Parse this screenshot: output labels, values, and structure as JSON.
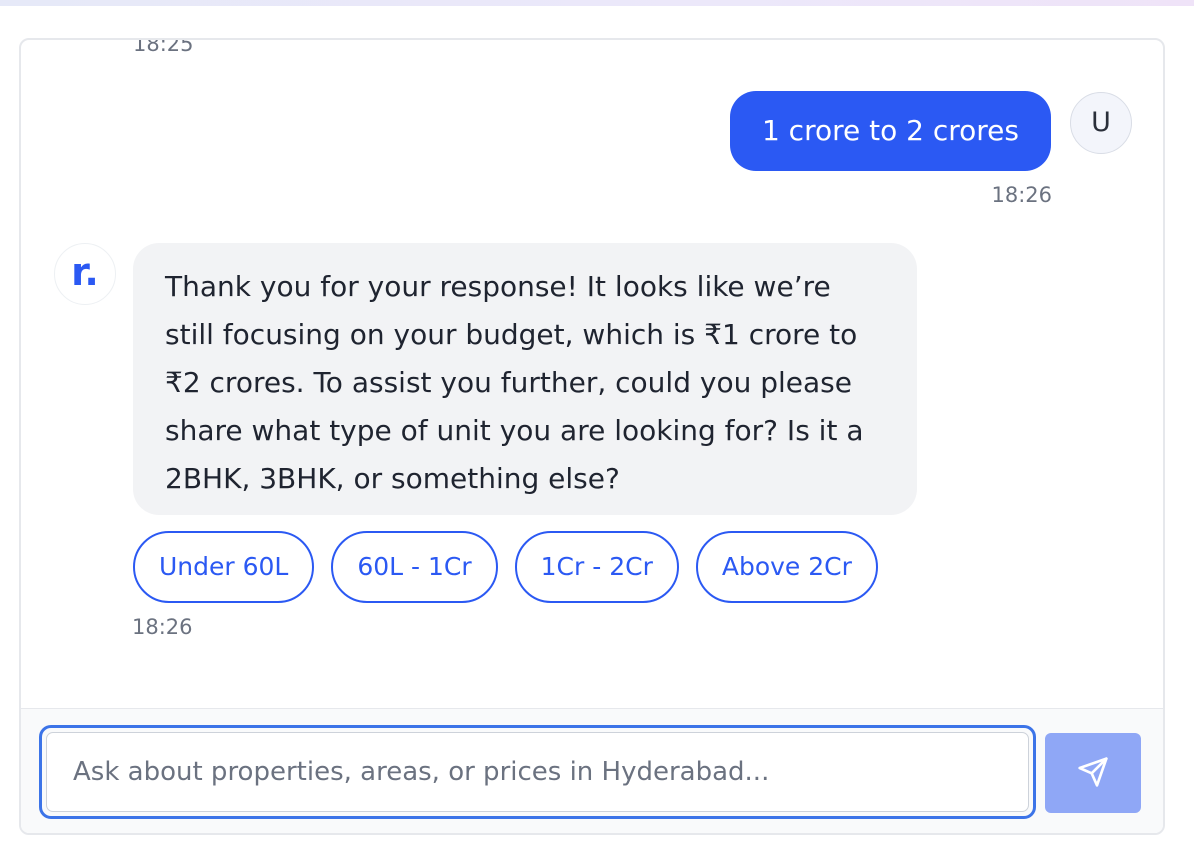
{
  "chat": {
    "previous_time": "18:25",
    "user_message": {
      "text": "1 crore to 2 crores",
      "time": "18:26",
      "avatar_letter": "U"
    },
    "bot_message": {
      "avatar_text": "r.",
      "text": "Thank you for your response! It looks like we’re still focusing on your budget, which is ₹1 crore to ₹2 crores. To assist you further, could you please share what type of unit you are looking for? Is it a 2BHK, 3BHK, or something else?",
      "time": "18:26",
      "quick_replies": [
        "Under 60L",
        "60L - 1Cr",
        "1Cr - 2Cr",
        "Above 2Cr"
      ]
    }
  },
  "input": {
    "placeholder": "Ask about properties, areas, or prices in Hyderabad...",
    "value": ""
  },
  "send_button": {
    "icon": "send-icon"
  },
  "colors": {
    "accent": "#2b59f3",
    "send_disabled": "#8fa7f6",
    "bot_bubble": "#f2f3f5",
    "input_focus": "#3c74e8"
  }
}
